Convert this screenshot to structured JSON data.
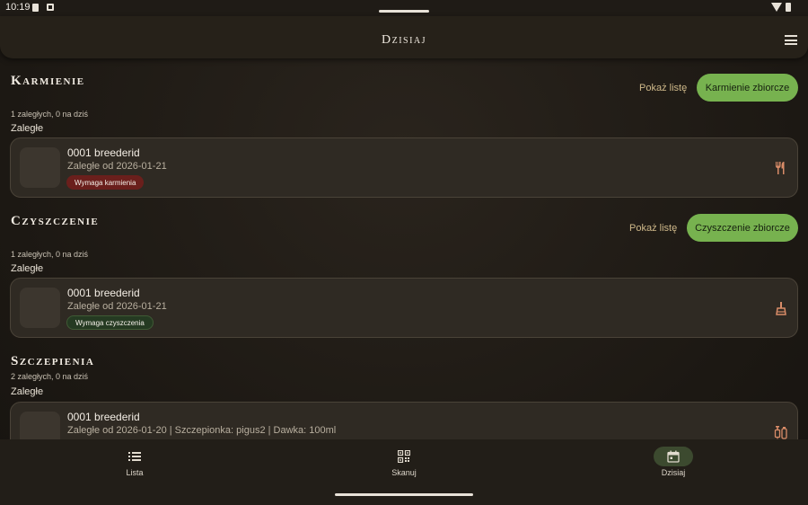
{
  "status": {
    "time": "10:19"
  },
  "appbar": {
    "title": "Dzisiaj"
  },
  "sections": [
    {
      "title": "Karmienie",
      "show_list": "Pokaż listę",
      "bulk_button": "Karmienie zbiorcze",
      "counts": "1 zaległych, 0 na dziś",
      "overdue_label": "Zaległe",
      "item": {
        "name": "0001 breederid",
        "subtitle": "Zaległe od 2026-01-21",
        "chip": "Wymaga karmienia",
        "icon": "utensils-icon"
      }
    },
    {
      "title": "Czyszczenie",
      "show_list": "Pokaż listę",
      "bulk_button": "Czyszczenie zbiorcze",
      "counts": "1 zaległych, 0 na dziś",
      "overdue_label": "Zaległe",
      "item": {
        "name": "0001 breederid",
        "subtitle": "Zaległe od 2026-01-21",
        "chip": "Wymaga czyszczenia",
        "icon": "broom-icon"
      }
    },
    {
      "title": "Szczepienia",
      "counts": "2 zaległych, 0 na dziś",
      "overdue_label": "Zaległe",
      "item": {
        "name": "0001 breederid",
        "subtitle": "Zaległe od 2026-01-20 | Szczepionka: pigus2 | Dawka: 100ml",
        "icon": "syringe-icon"
      }
    }
  ],
  "nav": [
    {
      "label": "Lista",
      "icon": "list-icon",
      "active": false
    },
    {
      "label": "Skanuj",
      "icon": "qr-code-icon",
      "active": false
    },
    {
      "label": "Dzisiaj",
      "icon": "calendar-icon",
      "active": true
    }
  ],
  "colors": {
    "accent": "#77b24f",
    "link": "#cfb98a",
    "icon_orange": "#d98c68",
    "chip_red": "#6a1f1c",
    "chip_green": "#253a22"
  }
}
